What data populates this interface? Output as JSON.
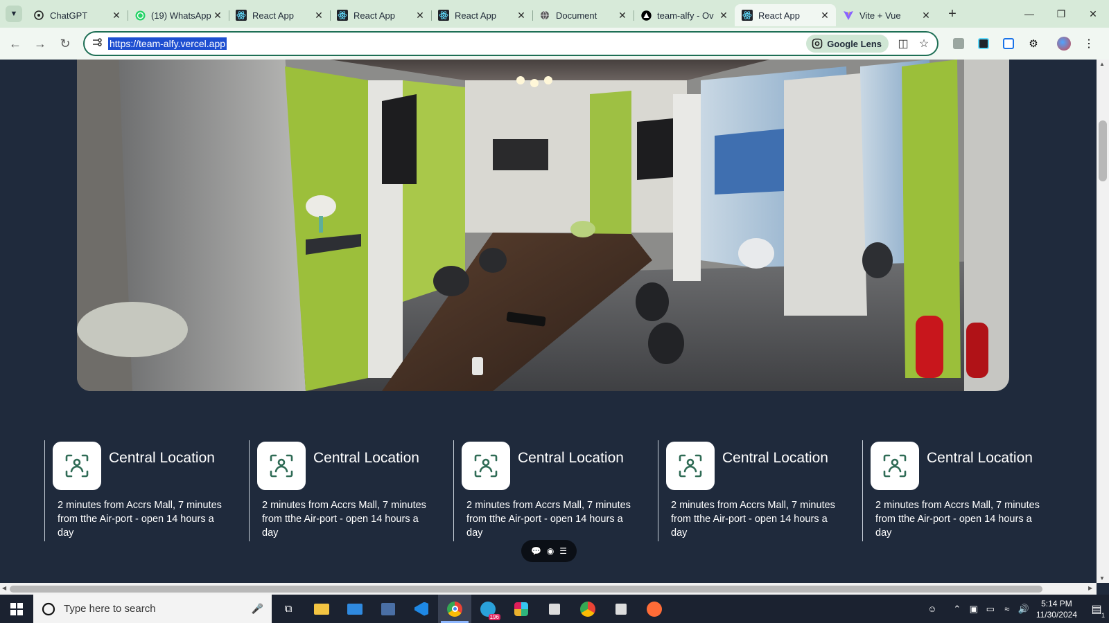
{
  "browser": {
    "tabs": [
      {
        "title": "ChatGPT",
        "icon": "chatgpt-icon",
        "active": false
      },
      {
        "title": "(19) WhatsApp",
        "icon": "whatsapp-icon",
        "active": false
      },
      {
        "title": "React App",
        "icon": "react-icon",
        "active": false
      },
      {
        "title": "React App",
        "icon": "react-icon",
        "active": false
      },
      {
        "title": "React App",
        "icon": "react-icon",
        "active": false
      },
      {
        "title": "Document",
        "icon": "globe-icon",
        "active": false
      },
      {
        "title": "team-alfy - Ov",
        "icon": "vercel-icon",
        "active": false
      },
      {
        "title": "React App",
        "icon": "react-icon",
        "active": true
      },
      {
        "title": "Vite + Vue",
        "icon": "vite-icon",
        "active": false
      }
    ],
    "url": "https://team-alfy.vercel.app",
    "lens_label": "Google Lens"
  },
  "page": {
    "hero_alt": "Coworking office with conference table",
    "features": [
      {
        "title": "Central Location",
        "description": "2 minutes from Accrs Mall, 7 minutes from tthe Air-port - open 14 hours a day",
        "icon": "location-scan-icon"
      },
      {
        "title": "Central Location",
        "description": "2 minutes from Accrs Mall, 7 minutes from tthe Air-port - open 14 hours a day",
        "icon": "location-scan-icon"
      },
      {
        "title": "Central Location",
        "description": "2 minutes from Accrs Mall, 7 minutes from tthe Air-port - open 14 hours a day",
        "icon": "location-scan-icon"
      },
      {
        "title": "Central Location",
        "description": "2 minutes from Accrs Mall, 7 minutes from tthe Air-port - open 14 hours a day",
        "icon": "location-scan-icon"
      },
      {
        "title": "Central Location",
        "description": "2 minutes from Accrs Mall, 7 minutes from tthe Air-port - open 14 hours a day",
        "icon": "location-scan-icon"
      }
    ]
  },
  "taskbar": {
    "search_placeholder": "Type here to search",
    "time": "5:14 PM",
    "date": "11/30/2024",
    "telegram_badge": "196",
    "notification_count": "1"
  },
  "colors": {
    "page_bg": "#1f2a3c",
    "accent_green": "#1e6f55",
    "icon_green": "#2f6b55"
  }
}
